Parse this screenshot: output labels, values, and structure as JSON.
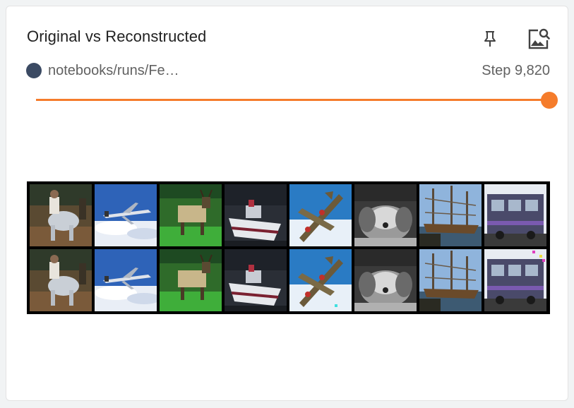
{
  "card": {
    "title": "Original vs Reconstructed",
    "icons": {
      "pin": "pin-icon",
      "image_search": "image-search-icon"
    }
  },
  "run": {
    "name": "notebooks/runs/Fe…",
    "color": "#3b4a63",
    "step_label": "Step 9,820"
  },
  "slider": {
    "value_fraction": 1.0,
    "accent": "#f57c2b"
  },
  "images": {
    "rows": [
      {
        "role": "original",
        "tiles": [
          "horse-rider",
          "airplane",
          "deer",
          "boat",
          "fighter-plane",
          "dog",
          "ship",
          "truck"
        ]
      },
      {
        "role": "reconstructed",
        "tiles": [
          "horse-rider",
          "airplane",
          "deer",
          "boat",
          "fighter-plane",
          "dog",
          "ship",
          "truck"
        ]
      }
    ]
  }
}
